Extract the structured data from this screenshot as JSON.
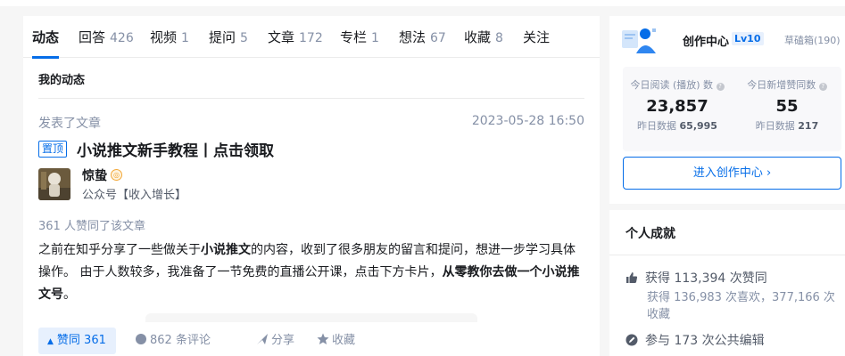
{
  "tabs": [
    {
      "label": "动态",
      "count": ""
    },
    {
      "label": "回答",
      "count": "426"
    },
    {
      "label": "视频",
      "count": "1"
    },
    {
      "label": "提问",
      "count": "5"
    },
    {
      "label": "文章",
      "count": "172"
    },
    {
      "label": "专栏",
      "count": "1"
    },
    {
      "label": "想法",
      "count": "67"
    },
    {
      "label": "收藏",
      "count": "8"
    },
    {
      "label": "关注",
      "count": ""
    }
  ],
  "feed": {
    "section_title": "我的动态",
    "item": {
      "action": "发表了文章",
      "date": "2023-05-28 16:50",
      "pin_label": "置顶",
      "title": "小说推文新手教程丨点击领取",
      "author": {
        "name": "惊蛰",
        "desc": "公众号【收入增长】"
      },
      "likes_line": "361 人赞同了该文章",
      "excerpt": {
        "p1": "之前在知乎分享了一些做关于",
        "b1": "小说推文",
        "p2": "的内容，收到了很多朋友的留言和提问，想进一步学习具体操作。 由于人数较多，我准备了一节免费的直播公开课，点击下方卡片，",
        "b2": "从零教你去做一个小说推文号",
        "p3": "。"
      },
      "actions": {
        "vote": "赞同 361",
        "comments": "862 条评论",
        "share": "分享",
        "favorite": "收藏"
      }
    }
  },
  "creator": {
    "title": "创作中心",
    "level": "Lv10",
    "user": "草磕箱(190)",
    "stats": [
      {
        "label": "今日阅读 (播放) 数",
        "value": "23,857",
        "sub_label": "昨日数据",
        "sub_value": "65,995"
      },
      {
        "label": "今日新增赞同数",
        "value": "55",
        "sub_label": "昨日数据",
        "sub_value": "217"
      }
    ],
    "enter_button": "进入创作中心 ›"
  },
  "achievements": {
    "title": "个人成就",
    "likes": "获得 113,394 次赞同",
    "likes_sub": "获得 136,983 次喜欢，377,166 次收藏",
    "edits": "参与 173 次公共编辑"
  },
  "colors": {
    "accent": "#056de8",
    "muted": "#8590a6",
    "bg": "#f6f6f6"
  }
}
